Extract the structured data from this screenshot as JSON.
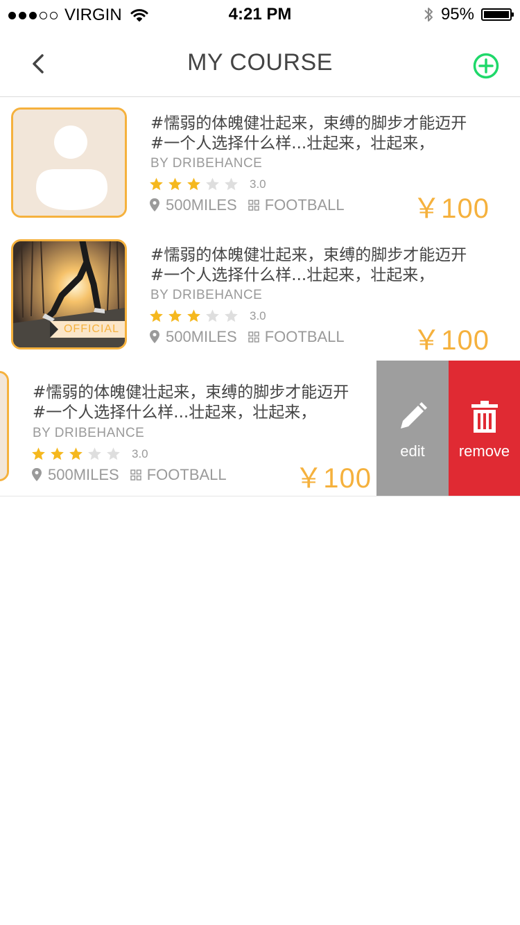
{
  "status_bar": {
    "carrier": "VIRGIN",
    "time": "4:21 PM",
    "battery": "95%"
  },
  "nav": {
    "title": "MY COURSE",
    "back_icon": "chevron-left-icon",
    "add_icon": "plus-circle-icon"
  },
  "colors": {
    "accent": "#f5b13d",
    "star_on": "#f5b81e",
    "star_off": "#dedede",
    "add": "#1fd86a",
    "edit_bg": "#9e9e9e",
    "remove_bg": "#e02a33"
  },
  "courses": [
    {
      "line1": "#懦弱的体魄健壮起来，束缚的脚步才能迈开",
      "line2": "#一个人选择什么样...壮起来，壮起来，",
      "author": "BY DRIBEHANCE",
      "rating": "3.0",
      "rating_value": 3,
      "distance": "500MILES",
      "category": "FOOTBALL",
      "price": "￥100",
      "thumb": "avatar-placeholder"
    },
    {
      "line1": "#懦弱的体魄健壮起来，束缚的脚步才能迈开",
      "line2": "#一个人选择什么样...壮起来，壮起来，",
      "author": "BY DRIBEHANCE",
      "rating": "3.0",
      "rating_value": 3,
      "distance": "500MILES",
      "category": "FOOTBALL",
      "price": "￥100",
      "thumb": "runner-photo",
      "badge": "OFFICIAL"
    },
    {
      "line1": "#懦弱的体魄健壮起来，束缚的脚步才能迈开",
      "line2": "#一个人选择什么样...壮起来，壮起来，",
      "author": "BY DRIBEHANCE",
      "rating": "3.0",
      "rating_value": 3,
      "distance": "500MILES",
      "category": "FOOTBALL",
      "price": "￥100",
      "thumb": "avatar-placeholder"
    }
  ],
  "swipe_actions": {
    "edit_label": "edit",
    "edit_icon": "pencil-icon",
    "remove_label": "remove",
    "remove_icon": "trash-icon"
  }
}
